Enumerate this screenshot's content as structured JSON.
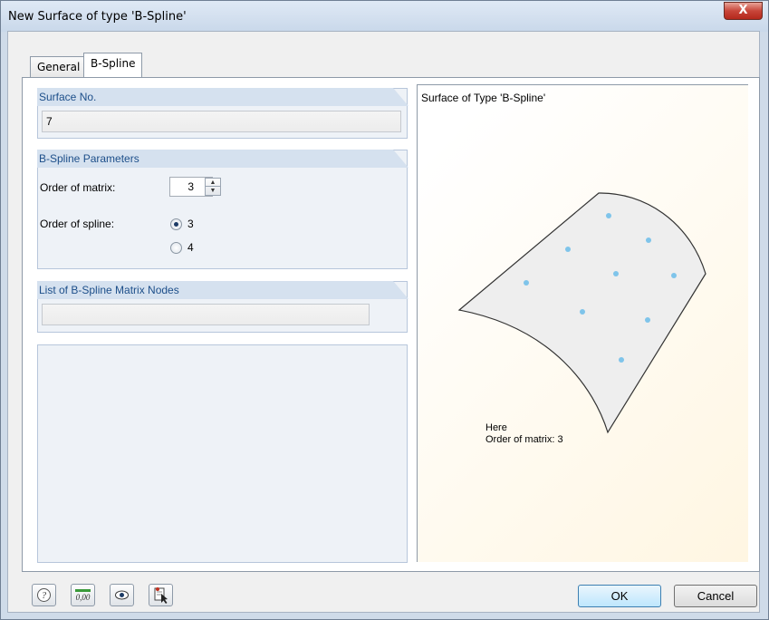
{
  "window": {
    "title": "New Surface of type 'B-Spline'",
    "close_label": "X"
  },
  "tabs": [
    {
      "label": "General"
    },
    {
      "label": "B-Spline"
    }
  ],
  "surface_no": {
    "header": "Surface No.",
    "value": "7"
  },
  "bspline_params": {
    "header": "B-Spline Parameters",
    "order_matrix_label": "Order of matrix:",
    "order_matrix_value": "3",
    "order_spline_label": "Order of spline:",
    "spline_options": [
      {
        "label": "3",
        "checked": true
      },
      {
        "label": "4",
        "checked": false
      }
    ]
  },
  "matrix_nodes": {
    "header": "List of B-Spline Matrix Nodes",
    "value": ""
  },
  "preview": {
    "title": "Surface of Type 'B-Spline'",
    "note_line1": "Here",
    "note_line2": "Order of matrix: 3"
  },
  "footer": {
    "icons": [
      "help-icon",
      "numeric-display-icon",
      "view-icon",
      "select-pointer-icon"
    ],
    "ok_label": "OK",
    "cancel_label": "Cancel"
  },
  "colors": {
    "accent_header": "#1d4f8a",
    "node_points": "#7fc4ea",
    "surface_fill": "#eeeeee"
  }
}
